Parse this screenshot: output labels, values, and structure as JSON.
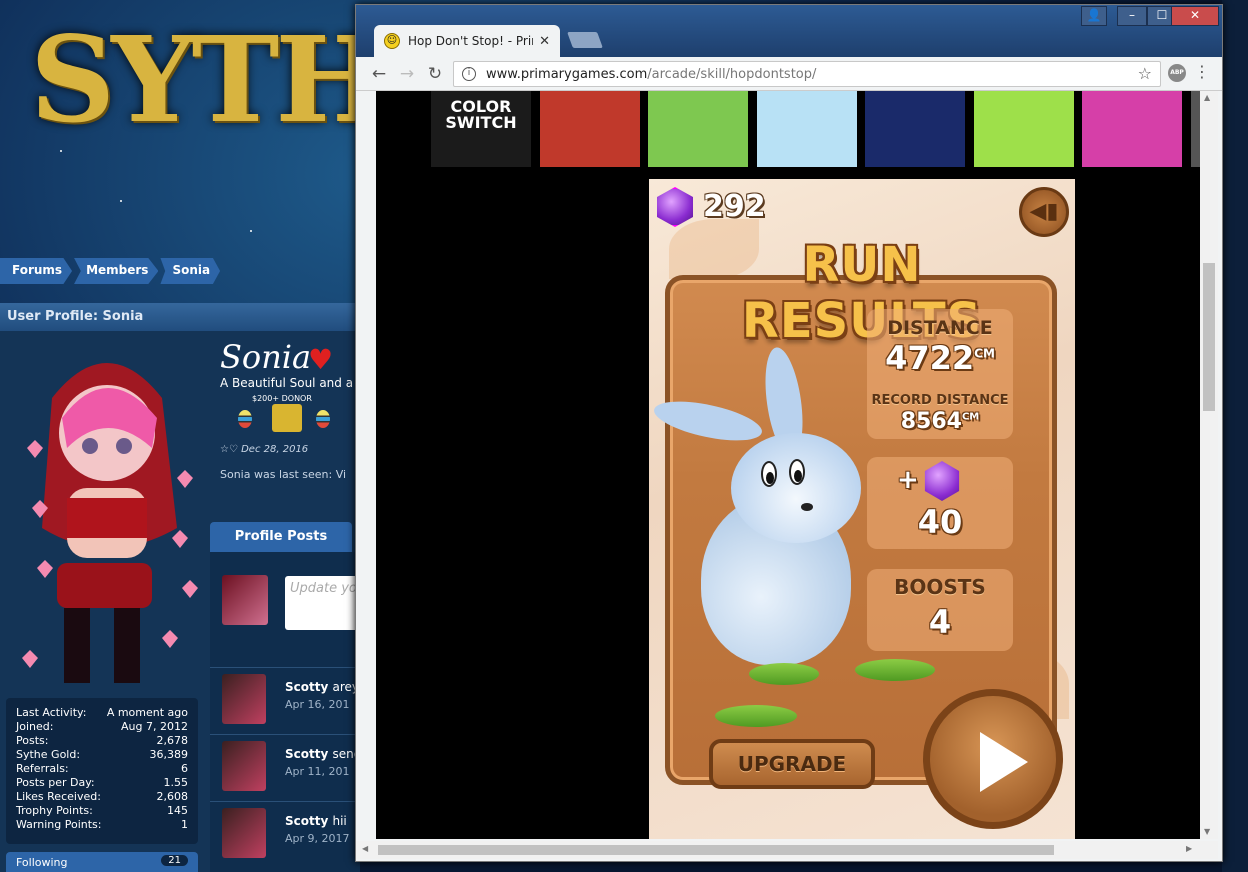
{
  "forum": {
    "logo_text": "SYTHE",
    "breadcrumbs": [
      "Forums",
      "Members",
      "Sonia"
    ],
    "profile_header": "User Profile: Sonia",
    "username": "Sonia",
    "user_title": "A Beautiful Soul and a",
    "donor_label": "$200+ DONOR",
    "join_date": "Dec 28, 2016",
    "last_seen": "Sonia was last seen: Vi",
    "stats": [
      {
        "label": "Last Activity:",
        "value": "A moment ago"
      },
      {
        "label": "Joined:",
        "value": "Aug 7, 2012"
      },
      {
        "label": "Posts:",
        "value": "2,678"
      },
      {
        "label": "Sythe Gold:",
        "value": "36,389"
      },
      {
        "label": "Referrals:",
        "value": "6"
      },
      {
        "label": "Posts per Day:",
        "value": "1.55"
      },
      {
        "label": "Likes Received:",
        "value": "2,608"
      },
      {
        "label": "Trophy Points:",
        "value": "145"
      },
      {
        "label": "Warning Points:",
        "value": "1"
      }
    ],
    "following_label": "Following",
    "following_count": "21",
    "tab_profile_posts": "Profile Posts",
    "update_placeholder": "Update yo",
    "posts": [
      {
        "author": "Scotty",
        "text": "arey",
        "date": "Apr 16, 201"
      },
      {
        "author": "Scotty",
        "text": "send",
        "date": "Apr 11, 201"
      },
      {
        "author": "Scotty",
        "text": "hii",
        "date": "Apr 9, 2017"
      }
    ]
  },
  "browser": {
    "tab_title": "Hop Don't Stop! - Primar",
    "url_host": "www.primarygames.com",
    "url_path": "/arcade/skill/hopdontstop/",
    "abp_label": "ABP",
    "window_buttons": {
      "minimize": "–",
      "maximize": "☐",
      "close": "✕"
    }
  },
  "thumbnails": [
    {
      "name": "color-switch",
      "label": "COLOR SWITCH",
      "bg": "#1b1b1b"
    },
    {
      "name": "burger",
      "label": "",
      "bg": "#c0392b"
    },
    {
      "name": "cat",
      "label": "",
      "bg": "#7ec850"
    },
    {
      "name": "house",
      "label": "",
      "bg": "#b8e1f5"
    },
    {
      "name": "billiards",
      "label": "",
      "bg": "#1a2a6a"
    },
    {
      "name": "frog",
      "label": "",
      "bg": "#9ee04a"
    },
    {
      "name": "powerpuff",
      "label": "",
      "bg": "#d63fa8"
    }
  ],
  "game": {
    "gems": "292",
    "title": "RUN RESULTS",
    "distance_label": "DISTANCE",
    "distance_value": "4722",
    "distance_unit": "CM",
    "record_label": "RECORD DISTANCE",
    "record_value": "8564",
    "record_unit": "CM",
    "gem_plus": "+",
    "gems_earned": "40",
    "boosts_label": "BOOSTS",
    "boosts_value": "4",
    "upgrade_label": "UPGRADE"
  }
}
